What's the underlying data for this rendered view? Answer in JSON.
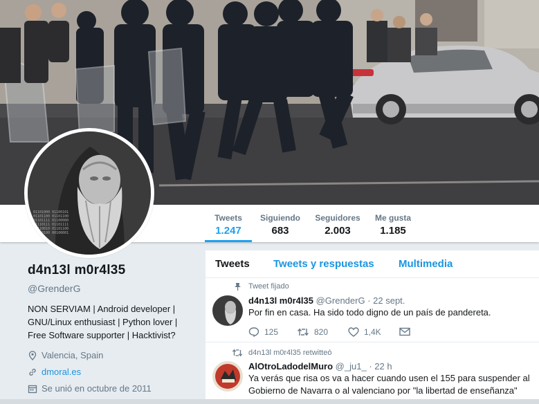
{
  "stats": [
    {
      "label": "Tweets",
      "value": "1.247",
      "active": true
    },
    {
      "label": "Siguiendo",
      "value": "683"
    },
    {
      "label": "Seguidores",
      "value": "2.003"
    },
    {
      "label": "Me gusta",
      "value": "1.185"
    }
  ],
  "profile": {
    "name": "d4n13l m0r4l35",
    "handle": "@GrenderG",
    "bio": "NON SERVIAM | Android developer | GNU/Linux enthusiast | Python lover | Free Software supporter | Hacktivist?",
    "location": "Valencia, Spain",
    "website": "dmoral.es",
    "joined": "Se unió en octubre de 2011"
  },
  "tabs": [
    "Tweets",
    "Tweets y respuestas",
    "Multimedia"
  ],
  "tweets": [
    {
      "context": "Tweet fijado",
      "name": "d4n13l m0r4l35",
      "handle": "@GrenderG",
      "date": "· 22 sept.",
      "text": "Por fin en casa. Ha sido todo digno de un país de pandereta.",
      "replies": "125",
      "retweets": "820",
      "likes": "1,4K"
    },
    {
      "context": "d4n13l m0r4l35 retwitteó",
      "name": "AlOtroLadodelMuro",
      "handle": "@_ju1_",
      "date": "· 22 h",
      "text": "Ya verás que risa os va a hacer cuando usen el 155 para suspender al Gobierno de Navarra  o al valenciano por \"la libertad de enseñanza\""
    }
  ],
  "colors": {
    "accent": "#1da1f2",
    "link": "#1b95e0",
    "muted": "#657786",
    "background": "#e6ecf0"
  }
}
